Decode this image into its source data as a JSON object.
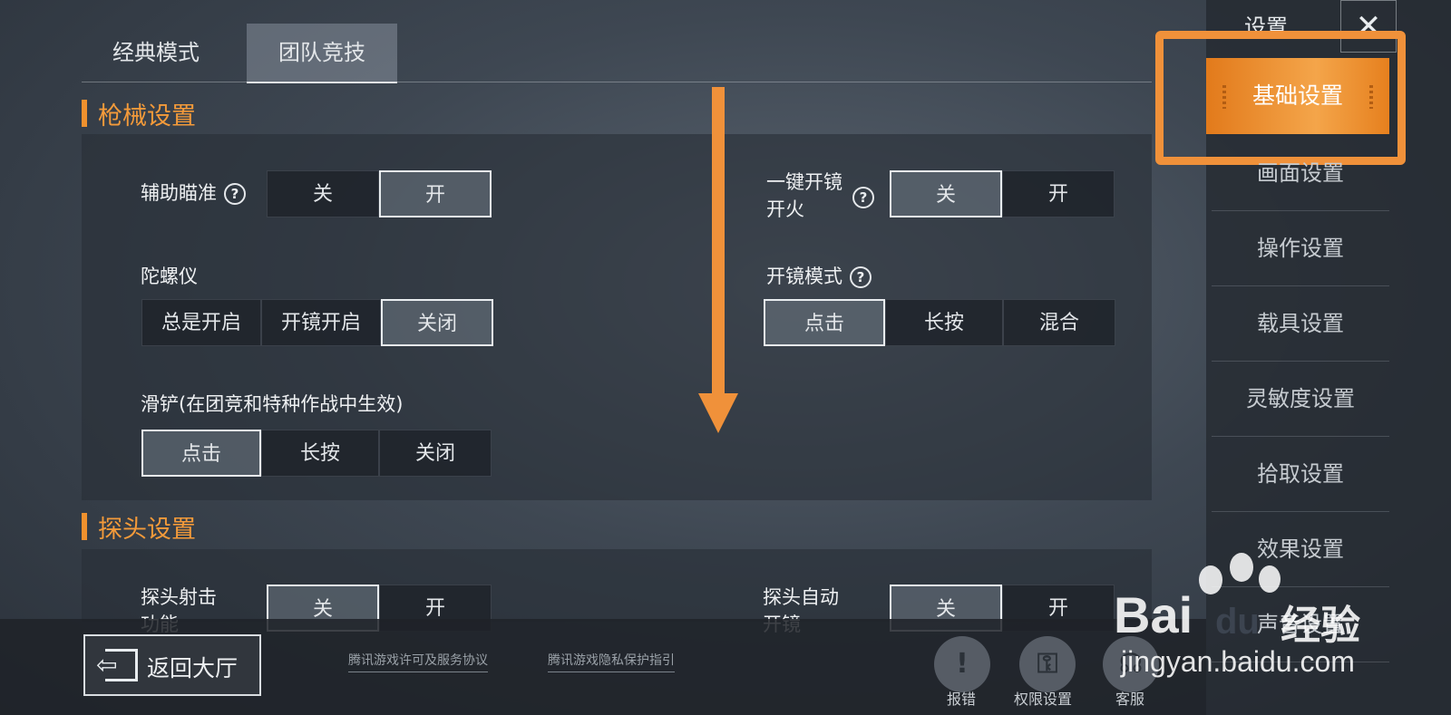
{
  "mode_tabs": [
    "经典模式",
    "团队竞技"
  ],
  "sections": {
    "weapon": {
      "title": "枪械设置",
      "aim_assist": {
        "label": "辅助瞄准",
        "options": [
          "关",
          "开"
        ],
        "selected": "开"
      },
      "one_tap_scope_fire": {
        "label_line1": "一键开镜",
        "label_line2": "开火",
        "options": [
          "关",
          "开"
        ],
        "selected": "关"
      },
      "gyroscope": {
        "label": "陀螺仪",
        "options": [
          "总是开启",
          "开镜开启",
          "关闭"
        ],
        "selected": "关闭"
      },
      "scope_mode": {
        "label": "开镜模式",
        "options": [
          "点击",
          "长按",
          "混合"
        ],
        "selected": "点击"
      },
      "slide": {
        "label": "滑铲(在团竞和特种作战中生效)",
        "options": [
          "点击",
          "长按",
          "关闭"
        ],
        "selected": "点击"
      }
    },
    "peek": {
      "title": "探头设置",
      "peek_fire": {
        "label_line1": "探头射击",
        "label_line2": "功能",
        "options": [
          "关",
          "开"
        ],
        "selected": "关"
      },
      "peek_auto_scope": {
        "label_line1": "探头自动",
        "label_line2": "开镜",
        "options": [
          "关",
          "开"
        ],
        "selected": "关"
      }
    }
  },
  "sidebar": {
    "title": "设置",
    "close_icon": "close-icon",
    "active": "基础设置",
    "items": [
      "画面设置",
      "操作设置",
      "载具设置",
      "灵敏度设置",
      "拾取设置",
      "效果设置",
      "声音设置"
    ]
  },
  "bottom": {
    "back_label": "返回大厅",
    "links": [
      "腾讯游戏许可及服务协议",
      "腾讯游戏隐私保护指引"
    ],
    "buttons": [
      {
        "label": "报错",
        "icon": "warning-icon"
      },
      {
        "label": "权限设置",
        "icon": "shield-key-icon"
      },
      {
        "label": "客服",
        "icon": "headset-icon"
      }
    ]
  },
  "watermark": {
    "brand": "Bai",
    "brand2": "du",
    "brand3": "经验",
    "url": "jingyan.baidu.com"
  },
  "colors": {
    "accent": "#f0913a",
    "active_tab_bg": "#e27a1b"
  }
}
